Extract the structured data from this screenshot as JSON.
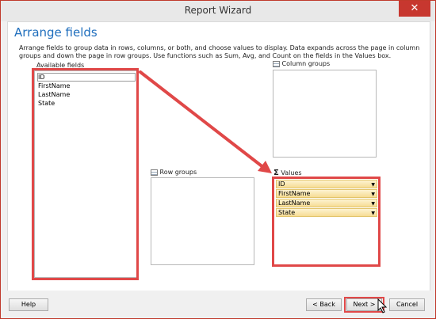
{
  "window": {
    "title": "Report Wizard",
    "close_symbol": "✕"
  },
  "page": {
    "heading": "Arrange fields",
    "description": "Arrange fields to group data in rows, columns, or both, and choose values to display. Data expands across the page in column groups and down the page in row groups.  Use functions such as Sum, Avg, and Count on the fields in the Values box."
  },
  "available_fields": {
    "label": "Available fields",
    "items": [
      "ID",
      "FirstName",
      "LastName",
      "State"
    ]
  },
  "column_groups": {
    "label": "Column groups"
  },
  "row_groups": {
    "label": "Row groups"
  },
  "values": {
    "label": "Values",
    "items": [
      "ID",
      "FirstName",
      "LastName",
      "State"
    ],
    "dropdown_symbol": "▼"
  },
  "footer": {
    "help": "Help",
    "back": "< Back",
    "next": "Next >",
    "cancel": "Cancel"
  },
  "colors": {
    "highlight": "#e04848",
    "heading": "#1f6ebd",
    "close_button": "#c7372f"
  }
}
